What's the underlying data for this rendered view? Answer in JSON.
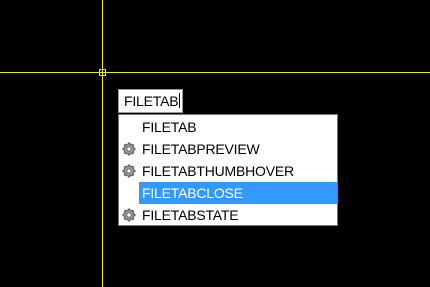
{
  "command_line": {
    "input_value": "FILETAB"
  },
  "autocomplete": {
    "items": [
      {
        "label": "FILETAB",
        "icon": "",
        "selected": false
      },
      {
        "label": "FILETABPREVIEW",
        "icon": "gear-icon",
        "selected": false
      },
      {
        "label": "FILETABTHUMBHOVER",
        "icon": "gear-icon",
        "selected": false
      },
      {
        "label": "FILETABCLOSE",
        "icon": "",
        "selected": true
      },
      {
        "label": "FILETABSTATE",
        "icon": "gear-icon",
        "selected": false
      }
    ]
  },
  "colors": {
    "background": "#000000",
    "crosshair": "#e8e82c",
    "selection": "#3399ff"
  }
}
